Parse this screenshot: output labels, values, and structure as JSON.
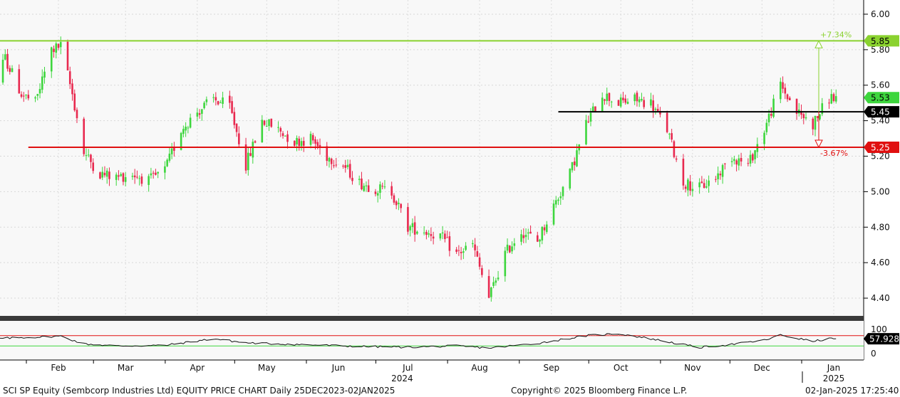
{
  "chart_data": {
    "type": "candlestick",
    "y_axis": {
      "ticks": [
        4.4,
        4.6,
        4.8,
        5.0,
        5.2,
        5.4,
        5.6,
        5.8,
        6.0
      ],
      "tick_labels": [
        "4.40",
        "4.60",
        "4.80",
        "5.00",
        "5.20",
        "5.40",
        "5.60",
        "5.80",
        "6.00"
      ],
      "ylim": [
        4.3,
        6.08
      ],
      "side": "right"
    },
    "x_axis": {
      "months": [
        {
          "label": "Feb",
          "date": "2024-02-01"
        },
        {
          "label": "Mar",
          "date": "2024-03-01"
        },
        {
          "label": "Apr",
          "date": "2024-04-01"
        },
        {
          "label": "May",
          "date": "2024-05-01"
        },
        {
          "label": "Jun",
          "date": "2024-06-01"
        },
        {
          "label": "Jul",
          "date": "2024-07-01"
        },
        {
          "label": "Aug",
          "date": "2024-08-01"
        },
        {
          "label": "Sep",
          "date": "2024-09-01"
        },
        {
          "label": "Oct",
          "date": "2024-10-01"
        },
        {
          "label": "Nov",
          "date": "2024-11-01"
        },
        {
          "label": "Dec",
          "date": "2024-12-01"
        },
        {
          "label": "Jan",
          "date": "2025-01-01"
        }
      ],
      "year_labels": [
        {
          "label": "2024",
          "date": "2024-07-01"
        },
        {
          "label": "2025",
          "date": "2025-01-01"
        }
      ],
      "range": [
        "2023-12-25",
        "2025-01-02"
      ]
    },
    "path": [
      [
        "2023-12-25",
        5.35
      ],
      [
        "2024-01-02",
        5.52
      ],
      [
        "2024-01-09",
        5.75
      ],
      [
        "2024-01-16",
        5.55
      ],
      [
        "2024-01-22",
        5.5
      ],
      [
        "2024-01-29",
        5.8
      ],
      [
        "2024-02-02",
        5.82
      ],
      [
        "2024-02-07",
        5.55
      ],
      [
        "2024-02-12",
        5.22
      ],
      [
        "2024-02-19",
        5.1
      ],
      [
        "2024-02-26",
        5.08
      ],
      [
        "2024-03-04",
        5.1
      ],
      [
        "2024-03-11",
        5.06
      ],
      [
        "2024-03-18",
        5.12
      ],
      [
        "2024-03-25",
        5.35
      ],
      [
        "2024-04-01",
        5.45
      ],
      [
        "2024-04-08",
        5.52
      ],
      [
        "2024-04-15",
        5.48
      ],
      [
        "2024-04-22",
        5.15
      ],
      [
        "2024-04-29",
        5.4
      ],
      [
        "2024-05-06",
        5.35
      ],
      [
        "2024-05-13",
        5.28
      ],
      [
        "2024-05-20",
        5.3
      ],
      [
        "2024-05-27",
        5.2
      ],
      [
        "2024-06-03",
        5.15
      ],
      [
        "2024-06-10",
        5.05
      ],
      [
        "2024-06-17",
        5.02
      ],
      [
        "2024-06-24",
        5.0
      ],
      [
        "2024-07-01",
        4.8
      ],
      [
        "2024-07-08",
        4.78
      ],
      [
        "2024-07-15",
        4.75
      ],
      [
        "2024-07-22",
        4.65
      ],
      [
        "2024-07-29",
        4.7
      ],
      [
        "2024-08-05",
        4.4
      ],
      [
        "2024-08-12",
        4.65
      ],
      [
        "2024-08-19",
        4.78
      ],
      [
        "2024-08-26",
        4.72
      ],
      [
        "2024-09-02",
        4.92
      ],
      [
        "2024-09-09",
        5.1
      ],
      [
        "2024-09-16",
        5.38
      ],
      [
        "2024-09-23",
        5.55
      ],
      [
        "2024-09-30",
        5.5
      ],
      [
        "2024-10-07",
        5.52
      ],
      [
        "2024-10-14",
        5.5
      ],
      [
        "2024-10-21",
        5.35
      ],
      [
        "2024-10-28",
        5.05
      ],
      [
        "2024-11-04",
        5.02
      ],
      [
        "2024-11-11",
        5.08
      ],
      [
        "2024-11-18",
        5.2
      ],
      [
        "2024-11-25",
        5.15
      ],
      [
        "2024-12-02",
        5.35
      ],
      [
        "2024-12-09",
        5.6
      ],
      [
        "2024-12-16",
        5.45
      ],
      [
        "2024-12-23",
        5.38
      ],
      [
        "2024-12-30",
        5.53
      ]
    ],
    "colors": {
      "up": "#3dd63d",
      "down": "#e8294f"
    },
    "horizontal_lines": [
      {
        "value": 5.85,
        "color": "#8ad22f",
        "label": "5.85",
        "text_color": "#000000",
        "from": "2023-12-29"
      },
      {
        "value": 5.45,
        "color": "#000000",
        "label": "5.45",
        "text_color": "#ffffff",
        "from": "2024-09-04"
      },
      {
        "value": 5.25,
        "color": "#e01010",
        "label": "5.25",
        "text_color": "#ffffff",
        "from": "2024-01-19"
      }
    ],
    "last_price": {
      "value": 5.53,
      "label": "5.53",
      "color": "#3dd63d"
    },
    "annotations": [
      {
        "text": "+7.34%",
        "color": "#8ad22f",
        "from": 5.45,
        "to": 5.85
      },
      {
        "text": "-3.67%",
        "color": "#e01010",
        "from": 5.45,
        "to": 5.25
      }
    ],
    "rsi": {
      "upper": 100,
      "lower": 0,
      "tick_labels": [
        "100",
        "0"
      ],
      "upper_band": 70,
      "lower_band": 30,
      "last_value": 57.928,
      "last_label": "57.928",
      "path": [
        [
          "2023-12-25",
          55
        ],
        [
          "2024-01-15",
          62
        ],
        [
          "2024-02-02",
          68
        ],
        [
          "2024-02-12",
          38
        ],
        [
          "2024-02-26",
          30
        ],
        [
          "2024-03-18",
          32
        ],
        [
          "2024-04-08",
          58
        ],
        [
          "2024-04-22",
          42
        ],
        [
          "2024-05-13",
          36
        ],
        [
          "2024-06-10",
          28
        ],
        [
          "2024-07-01",
          25
        ],
        [
          "2024-07-22",
          30
        ],
        [
          "2024-08-05",
          22
        ],
        [
          "2024-08-26",
          40
        ],
        [
          "2024-09-16",
          70
        ],
        [
          "2024-09-30",
          78
        ],
        [
          "2024-10-14",
          58
        ],
        [
          "2024-10-28",
          35
        ],
        [
          "2024-11-04",
          24
        ],
        [
          "2024-11-18",
          36
        ],
        [
          "2024-12-02",
          52
        ],
        [
          "2024-12-09",
          72
        ],
        [
          "2024-12-23",
          48
        ],
        [
          "2024-12-30",
          57.928
        ]
      ]
    }
  },
  "footer": {
    "left": "SCI SP Equity (Sembcorp Industries Ltd) EQUITY PRICE CHART  Daily 25DEC2023-02JAN2025",
    "center": "Copyright© 2025 Bloomberg Finance L.P.",
    "right": "02-Jan-2025 17:25:40"
  }
}
